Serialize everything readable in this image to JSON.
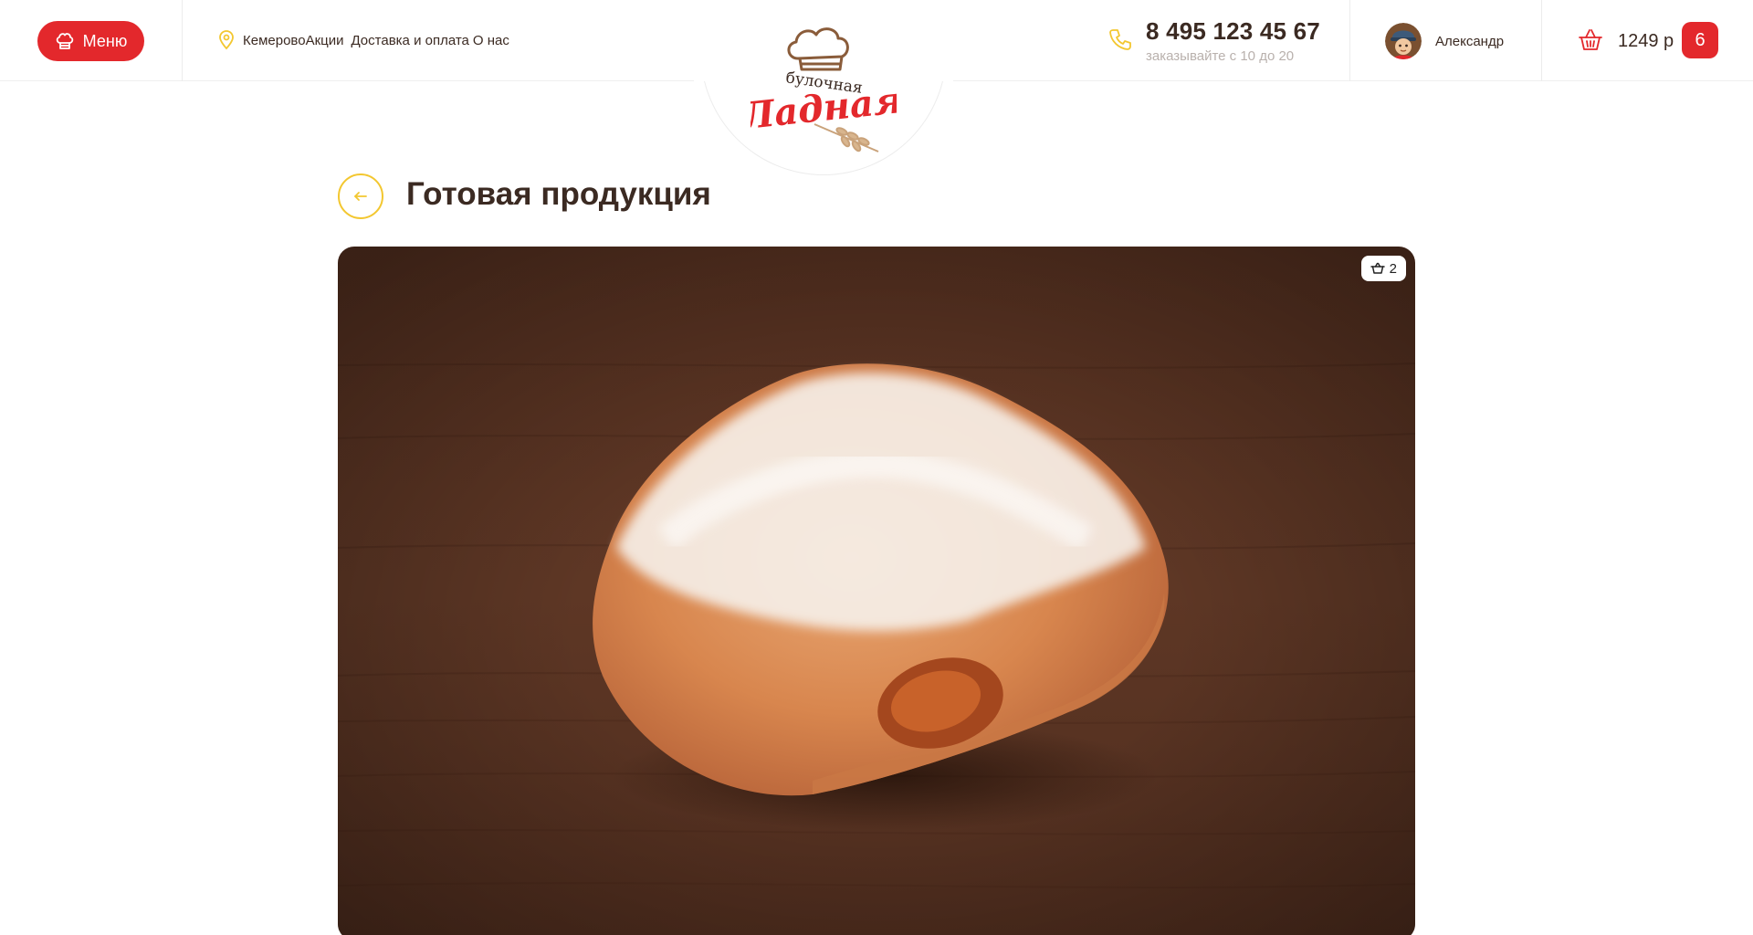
{
  "header": {
    "menu_label": "Меню",
    "nav": {
      "city": "Кемерово",
      "promo": "Акции",
      "delivery": "Доставка и оплата",
      "about": "О нас"
    },
    "logo": {
      "text_top": "булочная",
      "text_main": "Ладная"
    },
    "phone": {
      "number": "8 495 123 45 67",
      "hours": "заказывайте с 10 до 20"
    },
    "user": {
      "name": "Александр"
    },
    "cart": {
      "sum": "1249 р",
      "count": "6"
    }
  },
  "page": {
    "title": "Готовая продукция"
  },
  "product": {
    "badge_count": "2"
  },
  "colors": {
    "accent_red": "#e3282c",
    "accent_yellow": "#f3c730",
    "text_dark": "#3b2a22",
    "text_muted": "#b9b1ad",
    "photo_bg": "#5b3423"
  },
  "icons": {
    "menu": "chef-hat-icon",
    "location": "map-pin-icon",
    "phone": "phone-icon",
    "cart": "basket-icon",
    "back": "arrow-left-icon",
    "badge": "basket-icon"
  }
}
